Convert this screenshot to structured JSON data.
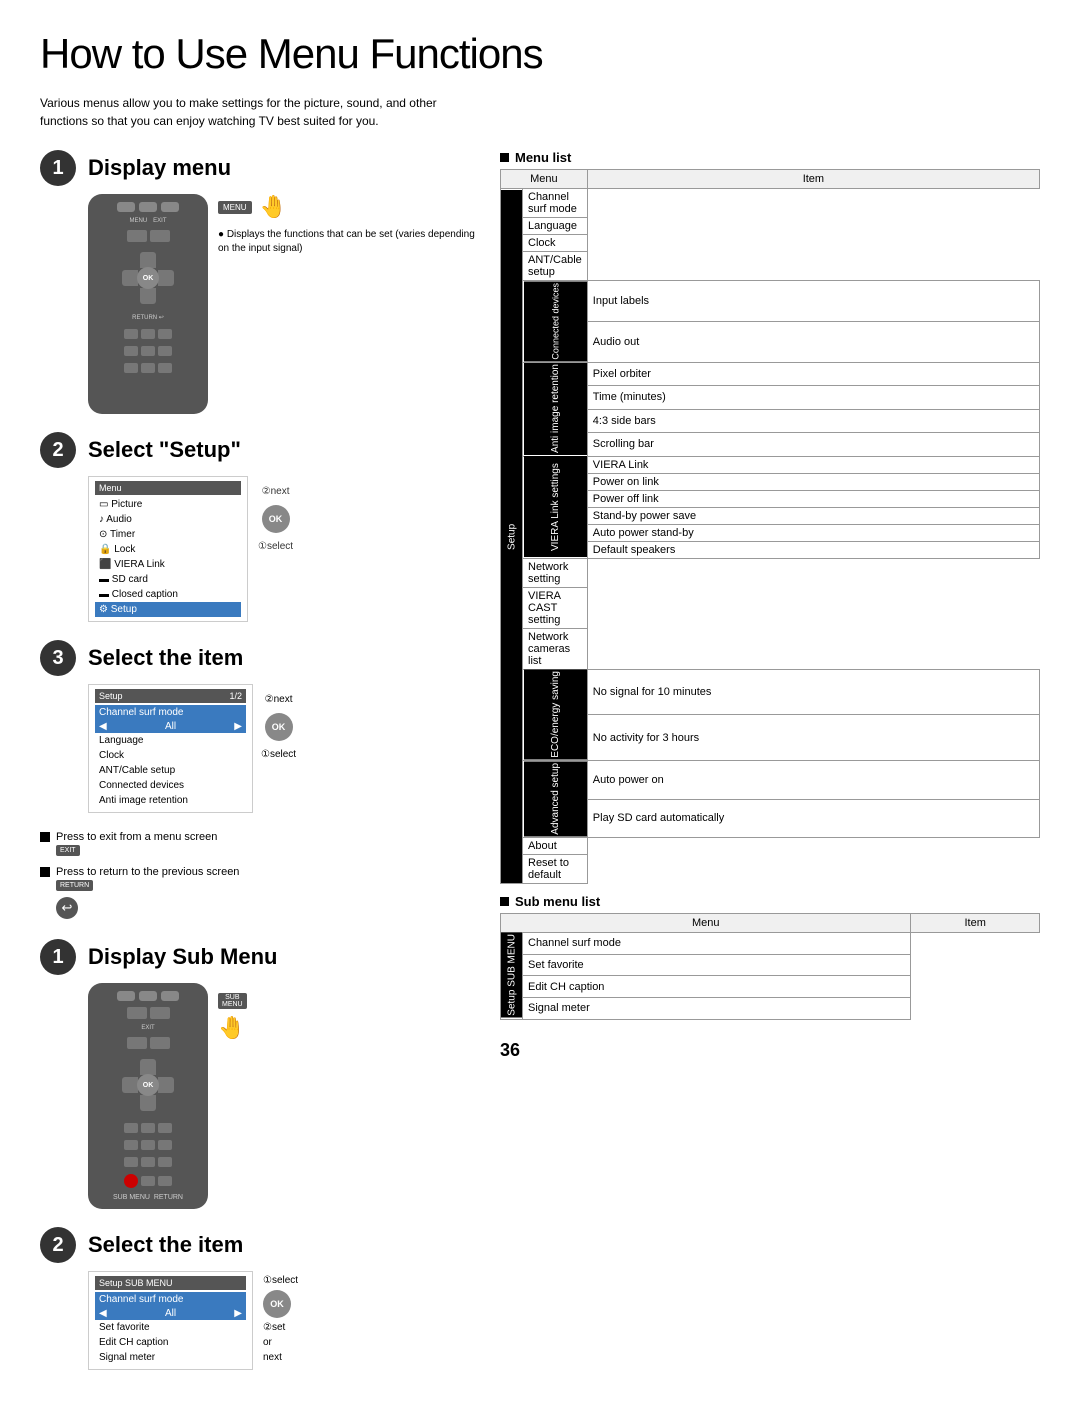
{
  "page": {
    "title": "How to Use Menu Functions",
    "intro": "Various menus allow you to make settings for the picture, sound, and other functions so that you can enjoy watching TV best suited for you.",
    "page_number": "36"
  },
  "steps": {
    "step1": {
      "number": "1",
      "title": "Display menu",
      "label": "MENU",
      "bullet": "Displays the functions that can be set (varies depending on the input signal)"
    },
    "step2": {
      "number": "2",
      "title": "Select \"Setup\"",
      "menu_header": "Menu",
      "items": [
        {
          "label": "Picture",
          "icon": "▭",
          "selected": false
        },
        {
          "label": "Audio",
          "icon": "♪",
          "selected": false
        },
        {
          "label": "Timer",
          "icon": "⊙",
          "selected": false
        },
        {
          "label": "Lock",
          "icon": "🔒",
          "selected": false
        },
        {
          "label": "VIERA Link",
          "icon": "⬛",
          "selected": false
        },
        {
          "label": "SD card",
          "icon": "▬",
          "selected": false
        },
        {
          "label": "Closed caption",
          "icon": "▬",
          "selected": false
        },
        {
          "label": "Setup",
          "icon": "⚙",
          "selected": true
        }
      ],
      "arrow_next": "②next",
      "arrow_select": "①select"
    },
    "step3_select": {
      "number": "3",
      "title": "Select the item",
      "menu_header": "Setup",
      "page_indicator": "1/2",
      "items": [
        {
          "label": "Channel surf mode",
          "selected": true
        },
        {
          "label": "All",
          "selected": false,
          "is_value": true
        },
        {
          "label": "Language",
          "selected": false
        },
        {
          "label": "Clock",
          "selected": false
        },
        {
          "label": "ANT/Cable setup",
          "selected": false
        },
        {
          "label": "Connected devices",
          "selected": false
        },
        {
          "label": "Anti image retention",
          "selected": false
        }
      ],
      "arrow_next": "②next",
      "arrow_select": "①select"
    }
  },
  "side_notes": {
    "exit_note": "Press to exit from a menu screen",
    "exit_btn": "EXIT",
    "return_note": "Press to return to the previous screen",
    "return_btn": "RETURN"
  },
  "sub_menu": {
    "step1": {
      "number": "1",
      "title": "Display Sub Menu",
      "label_sub": "SUB",
      "label_menu": "MENU"
    },
    "step2": {
      "number": "2",
      "title": "Select the item",
      "menu_header": "Setup SUB MENU",
      "items": [
        {
          "label": "Channel surf mode",
          "selected": true
        },
        {
          "label": "All",
          "selected": false,
          "is_value": true
        },
        {
          "label": "Set favorite",
          "selected": false
        },
        {
          "label": "Edit CH caption",
          "selected": false
        },
        {
          "label": "Signal meter",
          "selected": false
        }
      ],
      "arrow_select": "①select",
      "arrow_set": "②set",
      "arrow_or": "or",
      "arrow_next": "next"
    }
  },
  "menu_list": {
    "title": "Menu list",
    "header_menu": "Menu",
    "header_item": "Item",
    "setup_label": "Setup",
    "sections": [
      {
        "group_label": "",
        "items": [
          "Channel surf mode",
          "Language",
          "Clock",
          "ANT/Cable setup"
        ]
      },
      {
        "group_label": "Connected devices",
        "items": [
          "Input labels",
          "Audio out"
        ]
      },
      {
        "group_label": "Anti image retention",
        "items": [
          "Pixel orbiter",
          "Time (minutes)",
          "4:3 side bars",
          "Scrolling bar"
        ]
      },
      {
        "group_label": "VIERA Link settings",
        "items": [
          "VIERA Link",
          "Power on link",
          "Power off link",
          "Stand-by power save",
          "Auto power stand-by",
          "Default speakers"
        ]
      },
      {
        "group_label": "",
        "items": [
          "Network setting",
          "VIERA CAST setting",
          "Network cameras list"
        ]
      },
      {
        "group_label": "ECO/energy saving",
        "items": [
          "No signal for 10 minutes",
          "No activity for 3 hours"
        ]
      },
      {
        "group_label": "Advanced setup",
        "items": [
          "Auto power on",
          "Play SD card automatically"
        ]
      },
      {
        "group_label": "",
        "items": [
          "About",
          "Reset to default"
        ]
      }
    ]
  },
  "sub_menu_list": {
    "title": "Sub menu list",
    "header_menu": "Menu",
    "header_item": "Item",
    "sub_label": "Setup SUB MENU",
    "items": [
      "Channel surf mode",
      "Set favorite",
      "Edit CH caption",
      "Signal meter"
    ]
  }
}
